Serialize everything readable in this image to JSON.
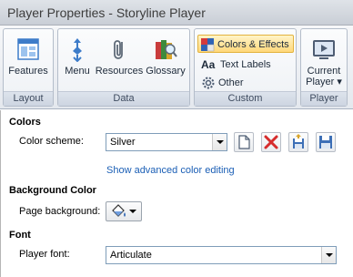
{
  "window": {
    "title": "Player Properties - Storyline Player"
  },
  "ribbon": {
    "layout": {
      "label": "Layout",
      "features_label": "Features"
    },
    "data": {
      "label": "Data",
      "menu_label": "Menu",
      "resources_label": "Resources",
      "glossary_label": "Glossary"
    },
    "custom": {
      "label": "Custom",
      "colors_effects_label": "Colors & Effects",
      "text_labels_label": "Text Labels",
      "other_label": "Other"
    },
    "player": {
      "label": "Player",
      "current_player_line1": "Current",
      "current_player_line2": "Player ▾"
    }
  },
  "colors": {
    "section_title": "Colors",
    "scheme_label": "Color scheme:",
    "scheme_value": "Silver",
    "advanced_link": "Show advanced color editing"
  },
  "background": {
    "section_title": "Background Color",
    "page_bg_label": "Page background:"
  },
  "font": {
    "section_title": "Font",
    "player_font_label": "Player font:",
    "player_font_value": "Articulate"
  },
  "accent_colors": {
    "selected_fill": "#ffd87a",
    "link": "#1a5eb5"
  }
}
